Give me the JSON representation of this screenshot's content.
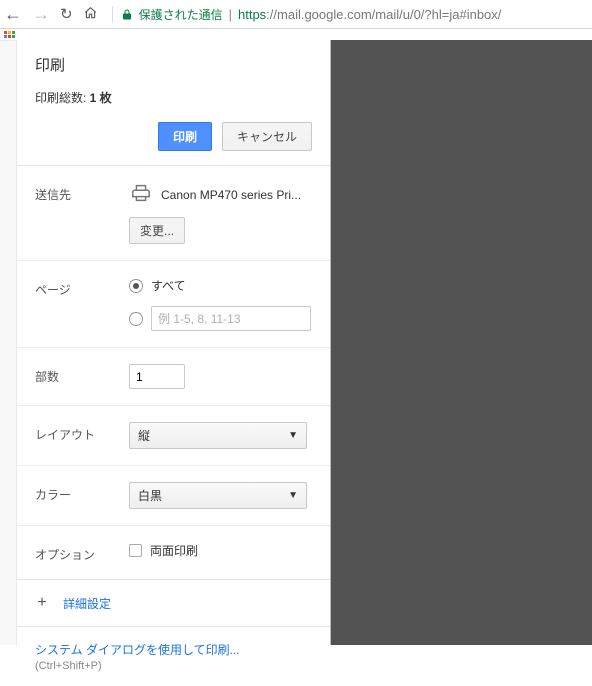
{
  "browser": {
    "secure_label": "保護された通信",
    "url_https": "https",
    "url_rest": "://mail.google.com/mail/u/0/?hl=ja#inbox/"
  },
  "header": {
    "title": "印刷",
    "total_prefix": "印刷総数: ",
    "total_count": "1 枚",
    "print_btn": "印刷",
    "cancel_btn": "キャンセル"
  },
  "destination": {
    "label": "送信先",
    "printer_name": "Canon MP470 series Pri...",
    "change_btn": "変更..."
  },
  "pages": {
    "label": "ページ",
    "all_label": "すべて",
    "range_placeholder": "例 1-5, 8, 11-13"
  },
  "copies": {
    "label": "部数",
    "value": "1"
  },
  "layout": {
    "label": "レイアウト",
    "value": "縦"
  },
  "color": {
    "label": "カラー",
    "value": "白黒"
  },
  "options": {
    "label": "オプション",
    "duplex_label": "両面印刷"
  },
  "more": {
    "label": "詳細設定"
  },
  "system": {
    "link": "システム ダイアログを使用して印刷...",
    "shortcut": "(Ctrl+Shift+P)"
  }
}
